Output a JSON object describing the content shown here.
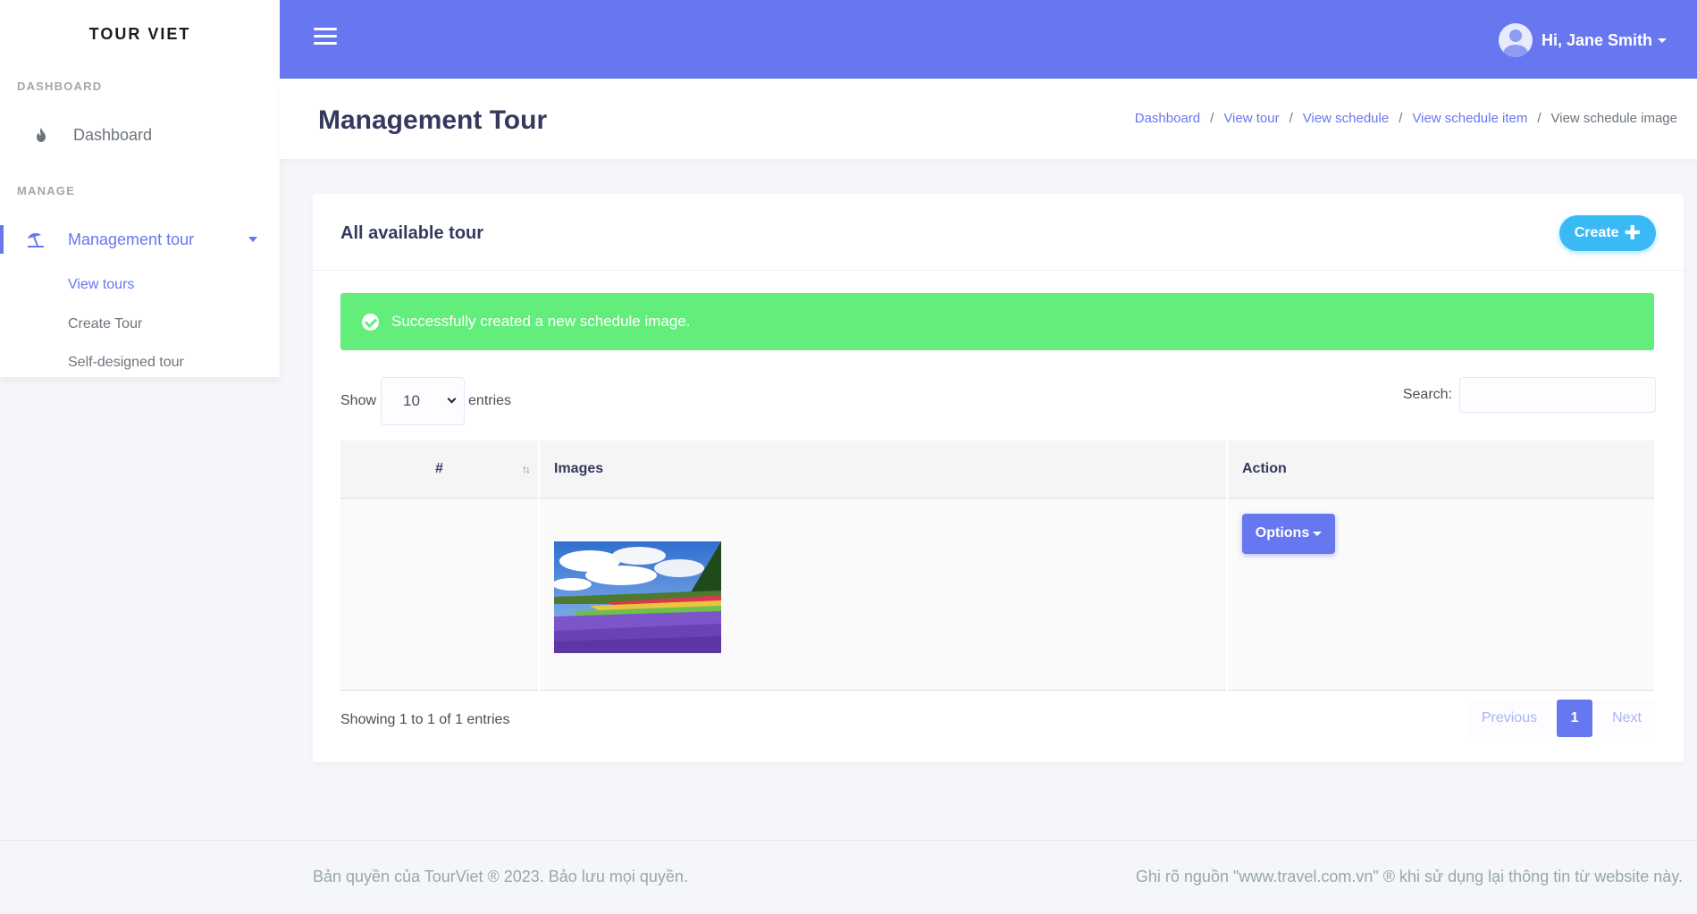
{
  "brand": "TOUR VIET",
  "colors": {
    "primary": "#6777ef",
    "info": "#3abaf4",
    "success": "#63ed7a"
  },
  "navbar": {
    "toggle_icon": "hamburger-icon",
    "user_greeting": "Hi, Jane Smith",
    "avatar_icon": "user-avatar-icon"
  },
  "sidebar": {
    "header_dashboard": "DASHBOARD",
    "dashboard_item": {
      "label": "Dashboard",
      "icon": "fire-icon"
    },
    "header_manage": "MANAGE",
    "management_item": {
      "label": "Management tour",
      "icon": "beach-umbrella-icon"
    },
    "submenu": [
      {
        "label": "View tours",
        "active": true
      },
      {
        "label": "Create Tour",
        "active": false
      },
      {
        "label": "Self-designed tour",
        "active": false
      }
    ]
  },
  "section": {
    "title": "Management Tour",
    "breadcrumb": [
      {
        "label": "Dashboard",
        "link": true
      },
      {
        "label": "View tour",
        "link": true
      },
      {
        "label": "View schedule",
        "link": true
      },
      {
        "label": "View schedule item",
        "link": true
      },
      {
        "label": "View schedule image",
        "link": false
      }
    ]
  },
  "card": {
    "title": "All available tour",
    "create_label": "Create",
    "create_icon": "plus-icon",
    "alert_text": "Successfully created a new schedule image.",
    "alert_icon": "check-circle-icon",
    "show_label": "Show",
    "entries_value": "10",
    "entries_label": "entries",
    "search_label": "Search:",
    "search_value": "",
    "table": {
      "columns": [
        "#",
        "Images",
        "Action"
      ],
      "rows": [
        {
          "num": "",
          "image": "flower-field-photo",
          "action_label": "Options"
        }
      ]
    },
    "info": "Showing 1 to 1 of 1 entries",
    "pagination": {
      "previous": "Previous",
      "current": "1",
      "next": "Next"
    }
  },
  "footer": {
    "left": "Bản quyền của TourViet ® 2023. Bảo lưu mọi quyền.",
    "right": "Ghi rõ nguồn \"www.travel.com.vn\" ® khi sử dụng lại thông tin từ website này."
  }
}
